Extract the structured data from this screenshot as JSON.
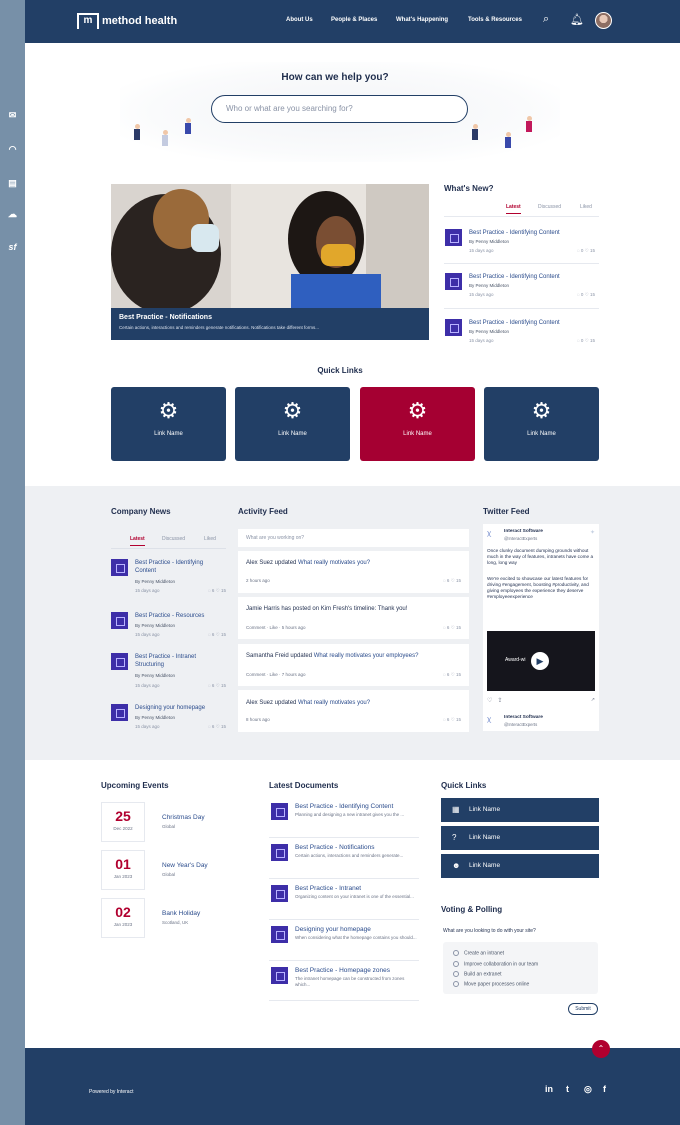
{
  "sidebar": {
    "icons": [
      "outlook-icon",
      "headset-icon",
      "exchange-icon",
      "cloud-icon",
      "salesforce-icon"
    ],
    "labels": [
      "✉",
      "◠",
      "▤",
      "☁",
      "sf"
    ]
  },
  "header": {
    "brand": "method health",
    "nav": [
      "About Us",
      "People & Places",
      "What's Happening",
      "Tools & Resources"
    ]
  },
  "hero": {
    "title": "How can we help you?",
    "search_placeholder": "Who or what are you searching for?"
  },
  "feature": {
    "title": "Best Practice - Notifications",
    "subtitle": "Certain actions, interactions and reminders generate notifications. Notifications take different forms..."
  },
  "whats_new": {
    "title": "What's New?",
    "tabs": [
      "Latest",
      "Discussed",
      "Liked"
    ],
    "items": [
      {
        "title": "Best Practice - Identifying Content",
        "author": "By Penny Middleton",
        "date": "15 days ago",
        "comments": "0",
        "likes": "15"
      },
      {
        "title": "Best Practice - Identifying Content",
        "author": "By Penny Middleton",
        "date": "15 days ago",
        "comments": "0",
        "likes": "15"
      },
      {
        "title": "Best Practice - Identifying Content",
        "author": "By Penny Middleton",
        "date": "15 days ago",
        "comments": "0",
        "likes": "15"
      }
    ]
  },
  "quick_links_tiles": {
    "title": "Quick Links",
    "tiles": [
      {
        "label": "Link Name",
        "color": "#223f66"
      },
      {
        "label": "Link Name",
        "color": "#223f66"
      },
      {
        "label": "Link Name",
        "color": "#a50032"
      },
      {
        "label": "Link Name",
        "color": "#223f66"
      }
    ]
  },
  "company_news": {
    "title": "Company News",
    "tabs": [
      "Latest",
      "Discussed",
      "Liked"
    ],
    "items": [
      {
        "title": "Best Practice - Identifying Content",
        "author": "By Penny Middleton",
        "date": "15 days ago",
        "comments": "6",
        "likes": "15"
      },
      {
        "title": "Best Practice - Resources",
        "author": "By Penny Middleton",
        "date": "15 days ago",
        "comments": "6",
        "likes": "15"
      },
      {
        "title": "Best Practice - Intranet Structuring",
        "author": "By Penny Middleton",
        "date": "15 days ago",
        "comments": "6",
        "likes": "15"
      },
      {
        "title": "Designing your homepage",
        "author": "By Penny Middleton",
        "date": "15 days ago",
        "comments": "6",
        "likes": "15"
      }
    ]
  },
  "activity": {
    "title": "Activity Feed",
    "placeholder": "What are you working on?",
    "items": [
      {
        "actor": "Alex Suez updated ",
        "target": "What really motivates you?",
        "meta": "2 hours ago",
        "comments": "6",
        "likes": "15"
      },
      {
        "actor": "Jamie Harris has posted on Kim Fresh's timeline: Thank you!",
        "target": "",
        "meta": "Comment · Like · 5 hours ago",
        "comments": "6",
        "likes": "15"
      },
      {
        "actor": "Samantha Freid updated ",
        "target": "What really motivates your employees?",
        "meta": "Comment · Like · 7 hours ago",
        "comments": "6",
        "likes": "15"
      },
      {
        "actor": "Alex Suez updated ",
        "target": "What really motivates you?",
        "meta": "8 hours ago",
        "comments": "6",
        "likes": "15"
      }
    ]
  },
  "twitter": {
    "title": "Twitter Feed",
    "account": "Interact Software",
    "handle": "@InteractExperts",
    "text1": "Once clunky document dumping grounds without much in the way of features, intranets have come a long, long way",
    "text2": "We're excited to showcase our latest features for driving #engagement, boosting #productivity, and giving employees the experience they deserve #employeeexperience",
    "video_label": "Award-wi"
  },
  "events": {
    "title": "Upcoming Events",
    "items": [
      {
        "day": "25",
        "month": "Dec 2022",
        "name": "Christmas Day",
        "loc": "Global"
      },
      {
        "day": "01",
        "month": "Jan 2023",
        "name": "New Year's Day",
        "loc": "Global"
      },
      {
        "day": "02",
        "month": "Jan 2023",
        "name": "Bank Holiday",
        "loc": "Scotland, UK"
      }
    ]
  },
  "documents": {
    "title": "Latest Documents",
    "items": [
      {
        "title": "Best Practice - Identifying Content",
        "desc": "Planning and designing a new intranet gives you the ..."
      },
      {
        "title": "Best Practice - Notifications",
        "desc": "Certain actions, interactions and reminders generate..."
      },
      {
        "title": "Best Practice - Intranet",
        "desc": "Organizing content on your intranet is one of the essential..."
      },
      {
        "title": "Designing your homepage",
        "desc": "When considering what the homepage contains you should..."
      },
      {
        "title": "Best Practice - Homepage zones",
        "desc": "The intranet homepage can be constructed from zones which..."
      }
    ]
  },
  "quick_links_list": {
    "title": "Quick Links",
    "items": [
      {
        "label": "Link Name",
        "icon": "▦"
      },
      {
        "label": "Link Name",
        "icon": "?"
      },
      {
        "label": "Link Name",
        "icon": "☻"
      }
    ]
  },
  "poll": {
    "title": "Voting & Polling",
    "question": "What are you looking to do with your site?",
    "options": [
      "Create an intranet",
      "Improve collaboration in our team",
      "Build an extranet",
      "Move paper processes online"
    ],
    "submit": "Submit"
  },
  "footer": {
    "powered": "Powered by  Interact",
    "social": [
      "in",
      "t",
      "◎",
      "f"
    ]
  }
}
